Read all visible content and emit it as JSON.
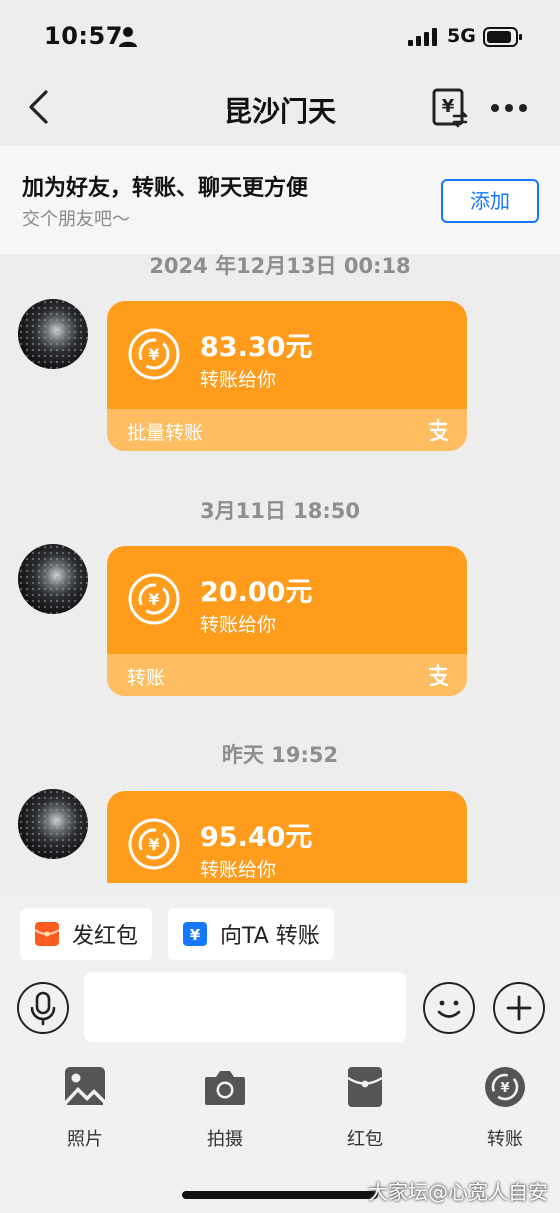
{
  "status_bar": {
    "time": "10:57",
    "network": "5G"
  },
  "nav": {
    "title": "昆沙门天"
  },
  "banner": {
    "title": "加为好友，转账、聊天更方便",
    "subtitle": "交个朋友吧～",
    "add_label": "添加"
  },
  "messages": [
    {
      "timestamp": "2024 年12月13日 00:18",
      "amount": "83.30元",
      "desc": "转账给你",
      "footer": "批量转账"
    },
    {
      "timestamp": "3月11日 18:50",
      "amount": "20.00元",
      "desc": "转账给你",
      "footer": "转账"
    },
    {
      "timestamp": "昨天 19:52",
      "amount": "95.40元",
      "desc": "转账给你"
    }
  ],
  "quick_actions": [
    {
      "label": "发红包",
      "icon": "red-envelope-icon",
      "color": "#ff5a1f"
    },
    {
      "label": "向TA 转账",
      "icon": "transfer-icon",
      "color": "#1677ff"
    }
  ],
  "input": {
    "placeholder": ""
  },
  "panel": [
    {
      "label": "照片",
      "icon": "photo-icon"
    },
    {
      "label": "拍摄",
      "icon": "camera-icon"
    },
    {
      "label": "红包",
      "icon": "red-packet-icon"
    },
    {
      "label": "转账",
      "icon": "transfer-coin-icon"
    }
  ],
  "watermark": "大家坛@心宽人自安",
  "colors": {
    "card": "#ff9c1b",
    "card_footer": "#ffbd61",
    "accent": "#1677ff"
  }
}
